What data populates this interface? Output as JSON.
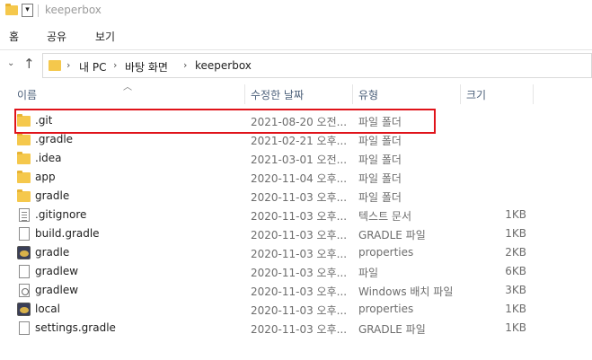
{
  "window": {
    "title": "keeperbox"
  },
  "ribbon": {
    "tabs": [
      "홈",
      "공유",
      "보기"
    ]
  },
  "address": {
    "crumbs": [
      "내 PC",
      "바탕 화면",
      "keeperbox"
    ]
  },
  "columns": {
    "name": "이름",
    "date": "수정한 날짜",
    "type": "유형",
    "size": "크기"
  },
  "files": [
    {
      "name": ".git",
      "date": "2021-08-20 오전...",
      "type": "파일 폴더",
      "size": "",
      "icon": "folder-icon"
    },
    {
      "name": ".gradle",
      "date": "2021-02-21 오후...",
      "type": "파일 폴더",
      "size": "",
      "icon": "folder-icon"
    },
    {
      "name": ".idea",
      "date": "2021-03-01 오전...",
      "type": "파일 폴더",
      "size": "",
      "icon": "folder-icon"
    },
    {
      "name": "app",
      "date": "2020-11-04 오후...",
      "type": "파일 폴더",
      "size": "",
      "icon": "folder-icon"
    },
    {
      "name": "gradle",
      "date": "2020-11-03 오후...",
      "type": "파일 폴더",
      "size": "",
      "icon": "folder-icon"
    },
    {
      "name": ".gitignore",
      "date": "2020-11-03 오후...",
      "type": "텍스트 문서",
      "size": "1KB",
      "icon": "text-file-icon"
    },
    {
      "name": "build.gradle",
      "date": "2020-11-03 오후...",
      "type": "GRADLE 파일",
      "size": "1KB",
      "icon": "blank-file-icon"
    },
    {
      "name": "gradle",
      "date": "2020-11-03 오후...",
      "type": "properties",
      "size": "2KB",
      "icon": "properties-file-icon"
    },
    {
      "name": "gradlew",
      "date": "2020-11-03 오후...",
      "type": "파일",
      "size": "6KB",
      "icon": "blank-file-icon"
    },
    {
      "name": "gradlew",
      "date": "2020-11-03 오후...",
      "type": "Windows 배치 파일",
      "size": "3KB",
      "icon": "batch-file-icon"
    },
    {
      "name": "local",
      "date": "2020-11-03 오후...",
      "type": "properties",
      "size": "1KB",
      "icon": "properties-file-icon"
    },
    {
      "name": "settings.gradle",
      "date": "2020-11-03 오후...",
      "type": "GRADLE 파일",
      "size": "1KB",
      "icon": "blank-file-icon"
    }
  ],
  "colors": {
    "highlight": "#e0131a",
    "folder": "#f5c84c",
    "header_text": "#4c607a"
  }
}
